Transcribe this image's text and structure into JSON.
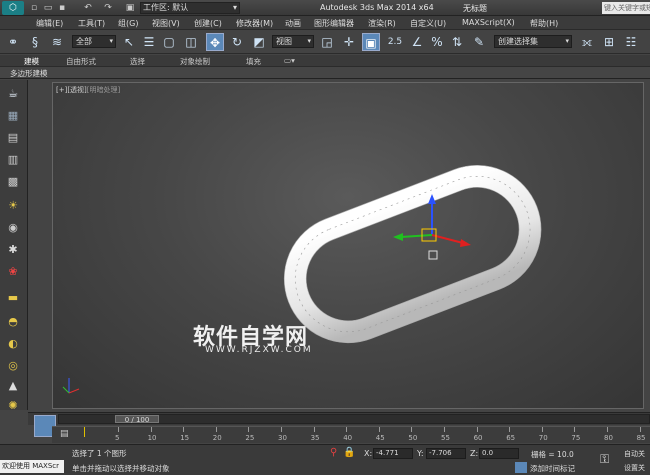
{
  "titlebar": {
    "workspace": "工作区: 默认",
    "app_title": "Autodesk 3ds Max  2014 x64",
    "file_title": "无标题",
    "search_placeholder": "键入关键字或短语"
  },
  "menu": [
    "编辑(E)",
    "工具(T)",
    "组(G)",
    "视图(V)",
    "创建(C)",
    "修改器(M)",
    "动画",
    "图形编辑器",
    "渲染(R)",
    "自定义(U)",
    "MAXScript(X)",
    "帮助(H)"
  ],
  "toolbar": {
    "selection_filter": "全部",
    "reference_coord": "视图",
    "named_selection": "创建选择集",
    "snap_label": "2.5"
  },
  "ribbon": {
    "tabs": [
      "建模",
      "自由形式",
      "选择",
      "对象绘制",
      "填充"
    ],
    "active_tab": "建模",
    "sub_label": "多边形建模"
  },
  "viewport": {
    "label_bracket": "[+]",
    "label_view": "[透视]",
    "label_mode": "[明暗处理]",
    "watermark_main": "软件自学网",
    "watermark_sub": "WWW.RJZXW.COM"
  },
  "timeline": {
    "thumb_label": "0 / 100",
    "ticks": [
      "5",
      "10",
      "15",
      "20",
      "25",
      "30",
      "35",
      "40",
      "45",
      "50",
      "55",
      "60",
      "65",
      "70",
      "75",
      "80",
      "85"
    ]
  },
  "status": {
    "welcome": "欢迎使用  MAXScr",
    "selection": "选择了 1 个图形",
    "prompt": "单击并拖动以选择并移动对象",
    "x_label": "X:",
    "x_value": "-4.771",
    "y_label": "Y:",
    "y_value": "-7.706",
    "z_label": "Z:",
    "z_value": "0.0",
    "grid": "栅格 = 10.0",
    "add_time_tag": "添加时间标记",
    "auto_key": "自动关",
    "set_key": "设置关"
  }
}
